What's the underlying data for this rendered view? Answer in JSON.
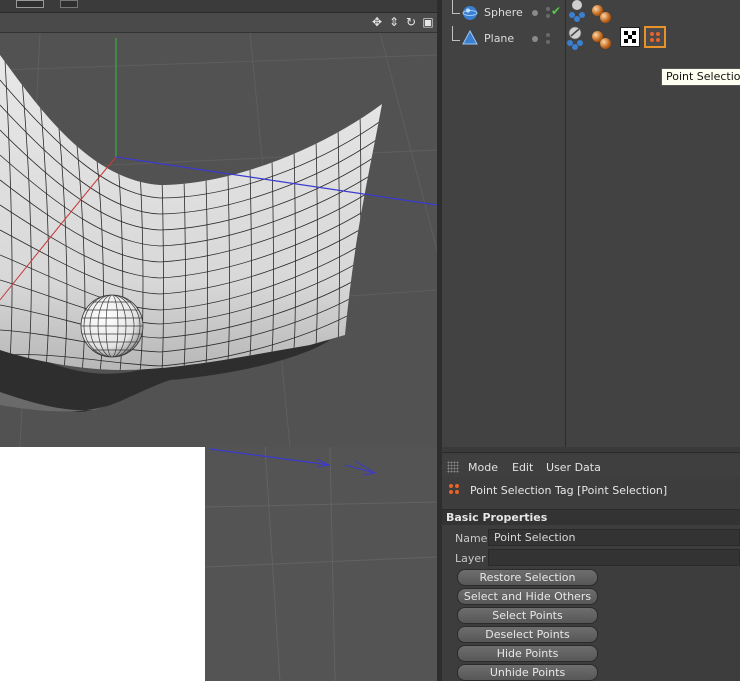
{
  "object_manager": {
    "objects": [
      {
        "name": "Sphere",
        "icon": "sphere-icon",
        "enabled_check": "✔"
      },
      {
        "name": "Plane",
        "icon": "plane-icon"
      }
    ],
    "tooltip": "Point Selection"
  },
  "attribute_manager": {
    "menu": [
      "Mode",
      "Edit",
      "User Data"
    ],
    "title": "Point Selection Tag [Point Selection]",
    "section": "Basic Properties",
    "fields": {
      "name_label": "Name",
      "name_value": "Point Selection",
      "layer_label": "Layer",
      "layer_value": ""
    },
    "buttons": [
      "Restore Selection",
      "Select and Hide Others",
      "Select Points",
      "Deselect Points",
      "Hide Points",
      "Unhide Points"
    ]
  },
  "viewport": {
    "nav_icons": [
      "move-icon",
      "zoom-icon",
      "rotate-icon",
      "layout-icon"
    ]
  },
  "colors": {
    "selection_orange": "#e8632a",
    "axis_x": "#c83a3a",
    "axis_y": "#3faa3f",
    "axis_z": "#3a3ad0"
  }
}
